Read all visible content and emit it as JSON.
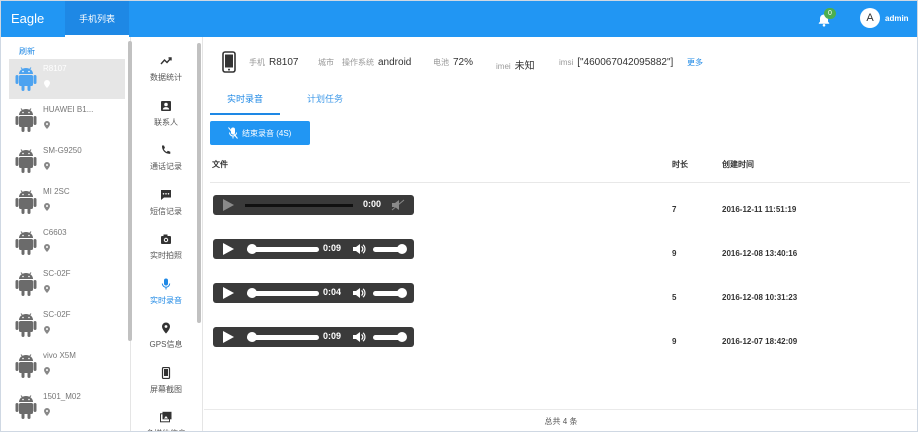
{
  "app": {
    "brand": "Eagle",
    "nav_tab": "手机列表",
    "notifications": "0",
    "avatar_letter": "A",
    "username": "admin"
  },
  "devices": {
    "refresh_label": "刷新",
    "items": [
      {
        "name": "R8107",
        "active": true
      },
      {
        "name": "HUAWEI B1..."
      },
      {
        "name": "SM-G9250"
      },
      {
        "name": "MI 2SC"
      },
      {
        "name": "C6603"
      },
      {
        "name": "SC-02F"
      },
      {
        "name": "SC-02F"
      },
      {
        "name": "vivo X5M"
      },
      {
        "name": "1501_M02"
      }
    ]
  },
  "functions": [
    {
      "label": "数据统计",
      "icon": "trend-icon"
    },
    {
      "label": "联系人",
      "icon": "contact-icon"
    },
    {
      "label": "通话记录",
      "icon": "phone-call-icon"
    },
    {
      "label": "短信记录",
      "icon": "sms-icon"
    },
    {
      "label": "实时拍照",
      "icon": "camera-icon"
    },
    {
      "label": "实时录音",
      "icon": "mic-icon",
      "active": true
    },
    {
      "label": "GPS信息",
      "icon": "location-icon"
    },
    {
      "label": "屏幕截图",
      "icon": "screenshot-icon"
    },
    {
      "label": "多媒体信息",
      "icon": "media-icon"
    }
  ],
  "device_info": {
    "phone_label": "手机",
    "phone_value": "R8107",
    "city_label": "城市",
    "os_label": "操作系统",
    "os_value": "android",
    "battery_label": "电池",
    "battery_value": "72%",
    "imei_label": "imei",
    "imei_value": "未知",
    "imsi_label": "imsi",
    "imsi_value": "[\"460067042095882\"]",
    "more_label": "更多"
  },
  "tabs": [
    {
      "label": "实时录音",
      "active": true
    },
    {
      "label": "计划任务"
    }
  ],
  "record_button": "结束录音 (4S)",
  "table": {
    "headers": {
      "file": "文件",
      "duration": "时长",
      "created": "创建时间"
    },
    "rows": [
      {
        "time": "0:00",
        "duration": "7",
        "created": "2016-12-11 11:51:19",
        "disabled": true
      },
      {
        "time": "0:09",
        "duration": "9",
        "created": "2016-12-08 13:40:16"
      },
      {
        "time": "0:04",
        "duration": "5",
        "created": "2016-12-08 10:31:23"
      },
      {
        "time": "0:09",
        "duration": "9",
        "created": "2016-12-07 18:42:09"
      }
    ]
  },
  "footer": "总共 4 条",
  "colors": {
    "primary": "#2196f3",
    "badge": "#4caf50",
    "player": "#3a3a3a"
  }
}
